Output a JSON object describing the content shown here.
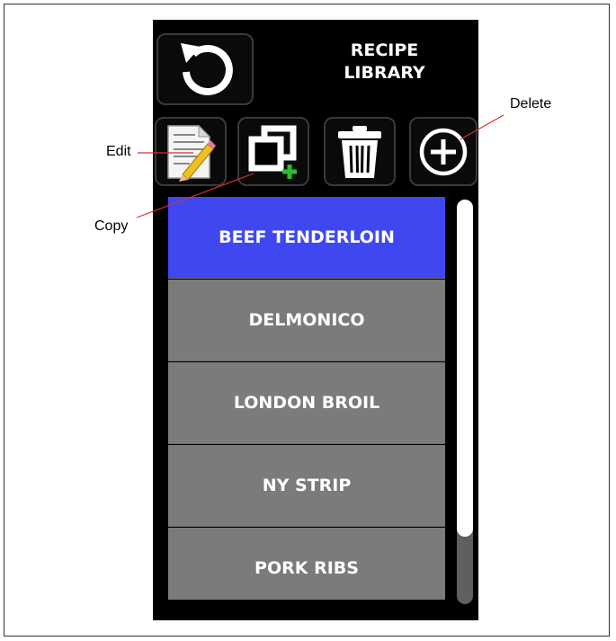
{
  "header": {
    "title_line1": "RECIPE",
    "title_line2": "LIBRARY"
  },
  "toolbar": {
    "back_icon": "refresh-back-icon",
    "edit_icon": "edit-document-icon",
    "copy_icon": "copy-icon",
    "delete_icon": "trash-icon",
    "add_icon": "add-circle-icon"
  },
  "recipes": [
    {
      "label": "BEEF TENDERLOIN",
      "selected": true
    },
    {
      "label": "DELMONICO",
      "selected": false
    },
    {
      "label": "LONDON BROIL",
      "selected": false
    },
    {
      "label": "NY STRIP",
      "selected": false
    },
    {
      "label": "PORK RIBS",
      "selected": false
    }
  ],
  "callouts": {
    "edit": "Edit",
    "copy": "Copy",
    "delete": "Delete"
  },
  "colors": {
    "selected": "#3f48f0",
    "item": "#7b7b7b",
    "callout_line": "#d0312d"
  }
}
